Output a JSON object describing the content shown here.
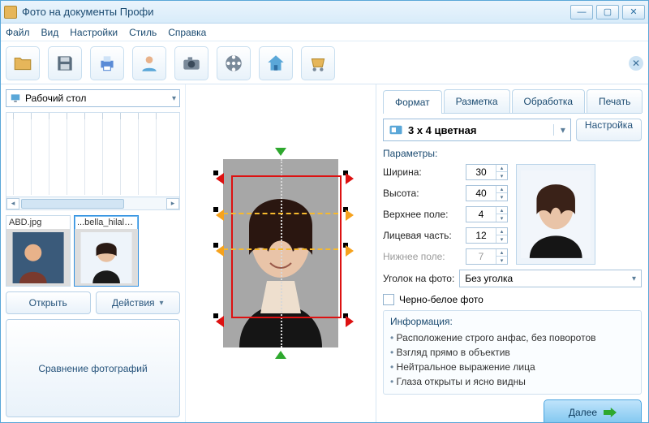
{
  "title": "Фото на документы Профи",
  "menu": {
    "file": "Файл",
    "view": "Вид",
    "settings": "Настройки",
    "style": "Стиль",
    "help": "Справка"
  },
  "toolbar_icons": [
    "open",
    "save",
    "print",
    "user",
    "camera",
    "reel",
    "home",
    "cart"
  ],
  "left": {
    "location": "Рабочий стол",
    "thumbs": [
      {
        "name": "ABD.jpg",
        "selected": false
      },
      {
        "name": "...bella_hilal.jpg",
        "selected": true
      }
    ],
    "open_btn": "Открыть",
    "actions_btn": "Действия",
    "compare_btn": "Сравнение фотографий"
  },
  "tabs": {
    "format": "Формат",
    "markup": "Разметка",
    "process": "Обработка",
    "print": "Печать",
    "active": "format"
  },
  "format": {
    "preset": "3 x 4 цветная",
    "config_btn": "Настройка",
    "params_label": "Параметры:",
    "width_label": "Ширина:",
    "width": "30",
    "height_label": "Высота:",
    "height": "40",
    "top_label": "Верхнее поле:",
    "top": "4",
    "face_label": "Лицевая часть:",
    "face": "12",
    "bottom_label": "Нижнее поле:",
    "bottom": "7",
    "corner_label": "Уголок на фото:",
    "corner_value": "Без уголка",
    "bw_label": "Черно-белое фото",
    "info_title": "Информация:",
    "info": [
      "Расположение строго анфас, без поворотов",
      "Взгляд прямо в объектив",
      "Нейтральное выражение лица",
      "Глаза открыты и ясно видны"
    ],
    "next": "Далее"
  }
}
